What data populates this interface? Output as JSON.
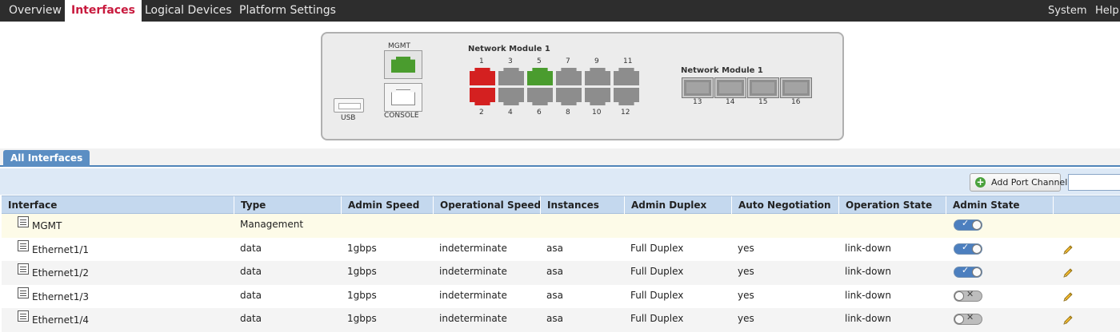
{
  "nav": {
    "left": [
      "Overview",
      "Interfaces",
      "Logical Devices",
      "Platform Settings"
    ],
    "active": "Interfaces",
    "right": [
      "System",
      "Help"
    ]
  },
  "chassis": {
    "mgmt_label": "MGMT",
    "console_label": "CONSOLE",
    "usb_label": "USB",
    "module_a_title": "Network Module 1",
    "module_b_title": "Network Module 1",
    "top_ports": [
      "1",
      "3",
      "5",
      "7",
      "9",
      "11"
    ],
    "bottom_ports": [
      "2",
      "4",
      "6",
      "8",
      "10",
      "12"
    ],
    "sfp_ports": [
      "13",
      "14",
      "15",
      "16"
    ],
    "port_status": {
      "1": "red",
      "2": "red",
      "3": "gray",
      "4": "gray",
      "5": "green",
      "6": "gray",
      "7": "gray",
      "8": "gray",
      "9": "gray",
      "10": "gray",
      "11": "gray",
      "12": "gray"
    },
    "colors": {
      "red": "#d42020",
      "green": "#4a9c2e",
      "gray": "#8d8d8d"
    }
  },
  "tab": {
    "label": "All Interfaces"
  },
  "toolbar": {
    "add_button": "Add Port Channel",
    "search_value": ""
  },
  "table": {
    "columns": [
      "Interface",
      "Type",
      "Admin Speed",
      "Operational Speed",
      "Instances",
      "Admin Duplex",
      "Auto Negotiation",
      "Operation State",
      "Admin State"
    ],
    "rows": [
      {
        "interface": "MGMT",
        "type": "Management",
        "admin_speed": "",
        "operational_speed": "",
        "instances": "",
        "admin_duplex": "",
        "auto_negotiation": "",
        "operation_state": "",
        "admin_state": "enabled"
      },
      {
        "interface": "Ethernet1/1",
        "type": "data",
        "admin_speed": "1gbps",
        "operational_speed": "indeterminate",
        "instances": "asa",
        "admin_duplex": "Full Duplex",
        "auto_negotiation": "yes",
        "operation_state": "link-down",
        "admin_state": "enabled"
      },
      {
        "interface": "Ethernet1/2",
        "type": "data",
        "admin_speed": "1gbps",
        "operational_speed": "indeterminate",
        "instances": "asa",
        "admin_duplex": "Full Duplex",
        "auto_negotiation": "yes",
        "operation_state": "link-down",
        "admin_state": "enabled"
      },
      {
        "interface": "Ethernet1/3",
        "type": "data",
        "admin_speed": "1gbps",
        "operational_speed": "indeterminate",
        "instances": "asa",
        "admin_duplex": "Full Duplex",
        "auto_negotiation": "yes",
        "operation_state": "link-down",
        "admin_state": "disabled"
      },
      {
        "interface": "Ethernet1/4",
        "type": "data",
        "admin_speed": "1gbps",
        "operational_speed": "indeterminate",
        "instances": "asa",
        "admin_duplex": "Full Duplex",
        "auto_negotiation": "yes",
        "operation_state": "link-down",
        "admin_state": "disabled"
      }
    ]
  }
}
